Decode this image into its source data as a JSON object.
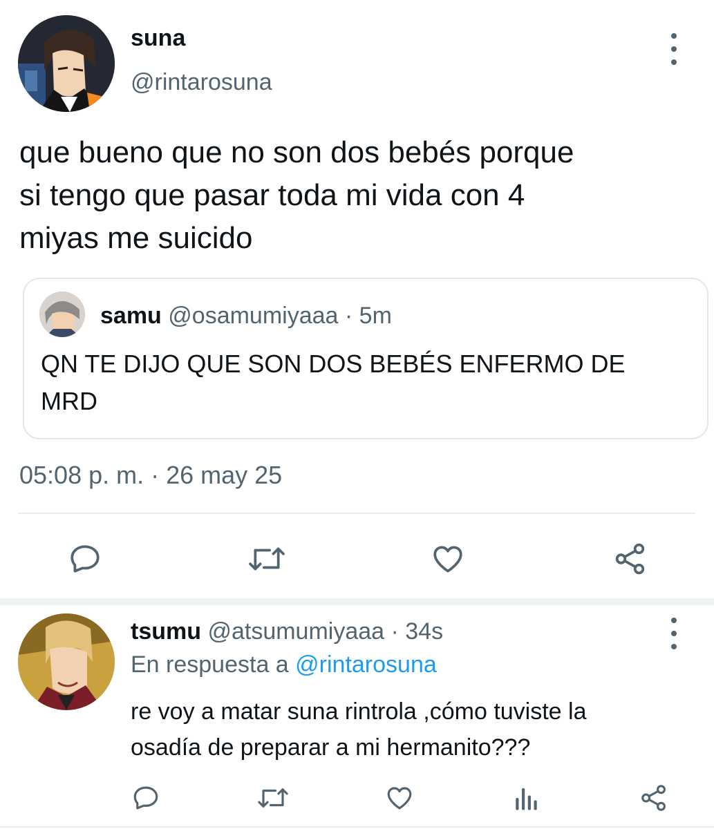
{
  "main_tweet": {
    "display_name": "suna",
    "handle": "@rintarosuna",
    "text_lines": [
      "que bueno que no son dos bebés porque",
      "si tengo que pasar toda mi vida con 4",
      "miyas me suicido"
    ],
    "timestamp": "05:08 p. m. · 26 may 25"
  },
  "quoted_tweet": {
    "display_name": "samu",
    "handle": "@osamumiyaaa",
    "age": "· 5m",
    "text_lines": [
      "QN TE DIJO QUE SON DOS BEBÉS ENFERMO DE",
      "MRD"
    ]
  },
  "reply_tweet": {
    "display_name": "tsumu",
    "handle": "@atsumumiyaaa",
    "age": "· 34s",
    "reply_prefix": "En respuesta a",
    "reply_to": "@rintarosuna",
    "text_lines": [
      "re voy a matar suna rintrola ,cómo tuviste la",
      "osadía de preparar a mi hermanito???"
    ]
  },
  "icons": {
    "main_actions": [
      "reply-icon",
      "retweet-icon",
      "like-icon",
      "share-icon"
    ],
    "reply_actions": [
      "reply-icon",
      "retweet-icon",
      "like-icon",
      "analytics-icon",
      "share-icon"
    ],
    "more": "more-vertical-icon"
  },
  "colors": {
    "text": "#0f1419",
    "muted": "#536471",
    "link": "#1d9bf0",
    "border": "#e1e8ed"
  }
}
